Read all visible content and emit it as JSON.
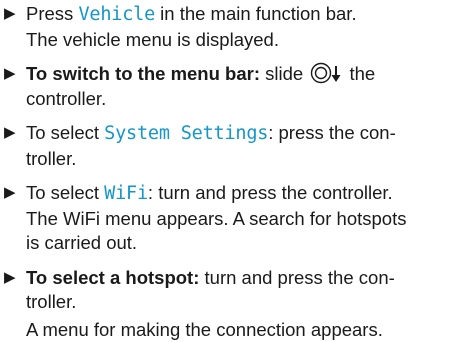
{
  "steps": [
    {
      "pre": "Press ",
      "code": "Vehicle",
      "post": " in the main function bar.",
      "result": "The vehicle menu is displayed."
    },
    {
      "bold": "To switch to the menu bar:",
      "pre": " slide ",
      "post": " the",
      "cont": "controller.",
      "icon": "controller-slide-down-icon"
    },
    {
      "pre": "To select ",
      "code": "System Settings",
      "post": ": press the con-",
      "cont": "troller."
    },
    {
      "pre": "To select ",
      "code": "WiFi",
      "post": ": turn and press the controller.",
      "result1": "The WiFi menu appears. A search for hotspots",
      "result2": "is carried out."
    },
    {
      "bold": "To select a hotspot:",
      "post": " turn and press the con-",
      "cont": "troller.",
      "result": "A menu for making the connection appears."
    }
  ]
}
